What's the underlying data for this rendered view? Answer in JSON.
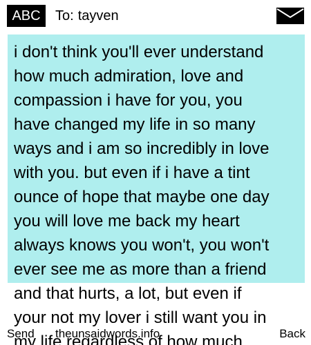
{
  "header": {
    "mode_label": "ABC",
    "to_label": "To:",
    "recipient": "tayven",
    "envelope_icon": "envelope-icon"
  },
  "message": {
    "lines": [
      "i don't think you'll ever understand",
      "how much admiration, love and",
      "compassion i have for you, you",
      "have changed my life in so many",
      "ways and i am so incredibly in love",
      "with you. but even if i have a tint",
      "ounce of hope that maybe one day",
      "you will love me back my heart",
      "always knows you won't, you won't",
      "ever see me as more than a friend",
      "and that hurts, a lot, but even if",
      "your not my lover i still want you in",
      "my life regardless of how much"
    ],
    "highlight_color": "#afeeee"
  },
  "softkeys": {
    "left": "Send",
    "center": "theunsaidwords.info",
    "right": "Back"
  }
}
